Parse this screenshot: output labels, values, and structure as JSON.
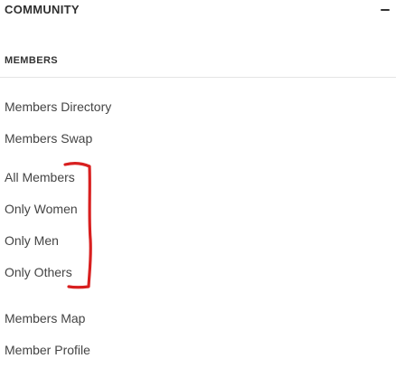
{
  "header": {
    "title": "COMMUNITY",
    "collapse_icon": "minus-icon"
  },
  "section": {
    "title": "MEMBERS"
  },
  "menu": {
    "items": [
      {
        "label": "Members Directory"
      },
      {
        "label": "Members Swap"
      },
      {
        "label": "All Members"
      },
      {
        "label": "Only Women"
      },
      {
        "label": "Only Men"
      },
      {
        "label": "Only Others"
      },
      {
        "label": "Members Map"
      },
      {
        "label": "Member Profile"
      }
    ]
  },
  "annotation": {
    "shape": "bracket",
    "color": "#d81f1f"
  }
}
